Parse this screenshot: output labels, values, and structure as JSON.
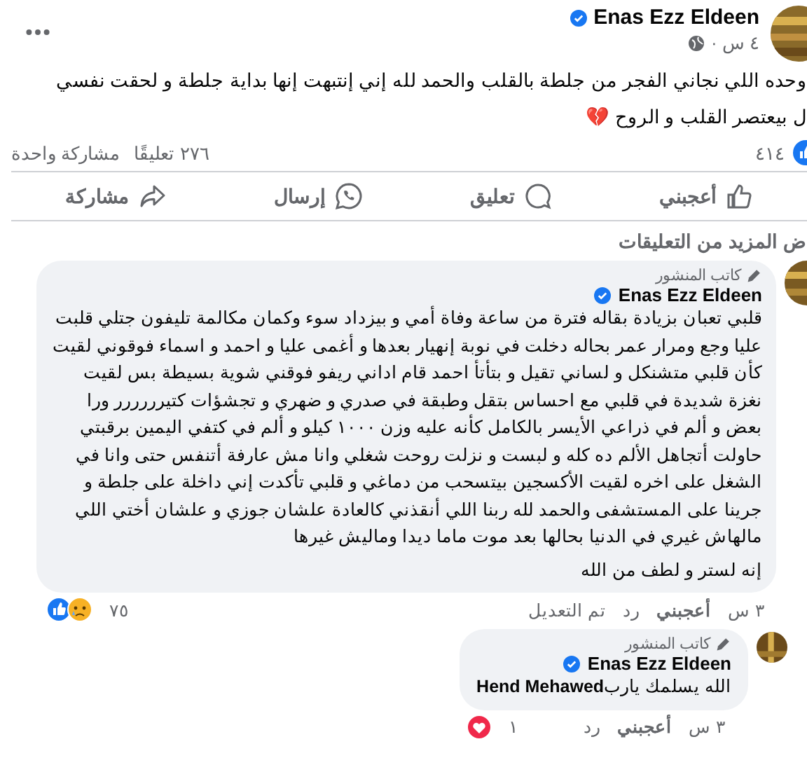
{
  "post": {
    "author": "Enas Ezz Eldeen",
    "verified": true,
    "time": "٤ س ·",
    "text_lines": [
      "وحده اللي نجاني الفجر من جلطة بالقلب والحمد لله إني إنتبهت إنها بداية جلطة و لحقت نفسي",
      "ل بيعتصر القلب و الروح 💔"
    ],
    "reactions_count": "٤١٤",
    "comments_count": "٢٧٦ تعليقًا",
    "shares_count": "مشاركة واحدة"
  },
  "actions": [
    {
      "kind": "like",
      "label": "أعجبني"
    },
    {
      "kind": "comment",
      "label": "تعليق"
    },
    {
      "kind": "send",
      "label": "إرسال"
    },
    {
      "kind": "share",
      "label": "مشاركة"
    }
  ],
  "more_comments": "ض المزيد من التعليقات",
  "comments": [
    {
      "badge": "كاتب المنشور",
      "author": "Enas Ezz Eldeen",
      "verified": true,
      "paragraphs": [
        "قلبي تعبان بزيادة بقاله فترة من ساعة وفاة أمي و بيزداد سوء وكمان مكالمة تليفون جتلي قلبت عليا وجع ومرار عمر بحاله دخلت في نوبة إنهيار بعدها و أغمى عليا و احمد و اسماء فوقوني لقيت كأن قلبي متشنكل و لساني تقيل و بتأتأ احمد قام اداني ريفو فوقني شوية بسيطة بس لقيت نغزة شديدة في قلبي مع احساس بتقل وطبقة في صدري و ضهري و تجشؤات كتيرررررر ورا بعض و ألم في ذراعي الأيسر بالكامل كأنه عليه وزن ١٠٠٠ كيلو و ألم في كتفي اليمين برقبتي حاولت أتجاهل الألم ده كله و لبست و نزلت روحت شغلي وانا مش عارفة أتنفس حتى وانا في الشغل على اخره لقيت الأكسجين بيتسحب من دماغي و قلبي تأكدت إني داخلة على جلطة و جرينا على المستشفى والحمد لله ربنا اللي أنقذني كالعادة علشان جوزي و علشان أختي اللي مالهاش غيري في الدنيا بحالها بعد موت ماما ديدا وماليش غيرها",
        "إنه لستر و لطف من الله"
      ],
      "time": "٣ س",
      "like": "أعجبني",
      "reply": "رد",
      "edited": "تم التعديل",
      "reactions": [
        {
          "kind": "like"
        },
        {
          "kind": "sad"
        }
      ],
      "reactions_count": "٧٥",
      "children": [
        {
          "badge": "كاتب المنشور",
          "author": "Enas Ezz Eldeen",
          "verified": true,
          "paragraphs": [
            "الله يسلمك يارب**Hend Mehawed**"
          ],
          "time": "٣ س",
          "like": "أعجبني",
          "reply": "رد",
          "reactions": [
            {
              "kind": "love"
            }
          ],
          "reactions_count": "١"
        }
      ]
    }
  ]
}
